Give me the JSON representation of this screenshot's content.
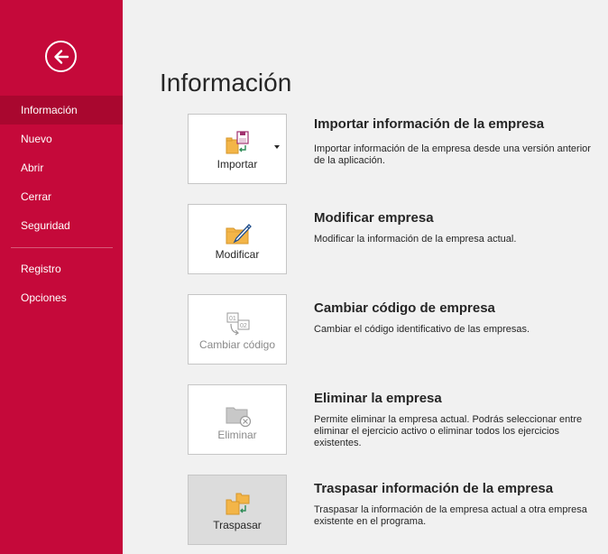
{
  "sidebar": {
    "back_icon": "back-arrow-icon",
    "accent_color": "#c5093a",
    "items": [
      {
        "label": "Información",
        "active": true
      },
      {
        "label": "Nuevo"
      },
      {
        "label": "Abrir"
      },
      {
        "label": "Cerrar"
      },
      {
        "label": "Seguridad"
      },
      {
        "label": "Registro"
      },
      {
        "label": "Opciones"
      }
    ]
  },
  "main": {
    "title": "Información",
    "sections": [
      {
        "button_label": "Importar",
        "icon": "import-icon",
        "has_dropdown": true,
        "title": "Importar información de la empresa",
        "description": "Importar información de la empresa desde una versión anterior de la aplicación."
      },
      {
        "button_label": "Modificar",
        "icon": "edit-folder-icon",
        "title": "Modificar empresa",
        "description": "Modificar la información de la empresa actual."
      },
      {
        "button_label": "Cambiar código",
        "icon": "change-code-icon",
        "disabled": true,
        "title": "Cambiar código de empresa",
        "description": "Cambiar el código identificativo de las empresas."
      },
      {
        "button_label": "Eliminar",
        "icon": "delete-folder-icon",
        "disabled": true,
        "title": "Eliminar la empresa",
        "description": "Permite eliminar la empresa actual. Podrás seleccionar entre eliminar el ejercicio activo o eliminar todos los ejercicios existentes."
      },
      {
        "button_label": "Traspasar",
        "icon": "transfer-icon",
        "title": "Traspasar información de la empresa",
        "description": "Traspasar la información de la empresa actual a otra empresa existente en el programa."
      }
    ]
  }
}
